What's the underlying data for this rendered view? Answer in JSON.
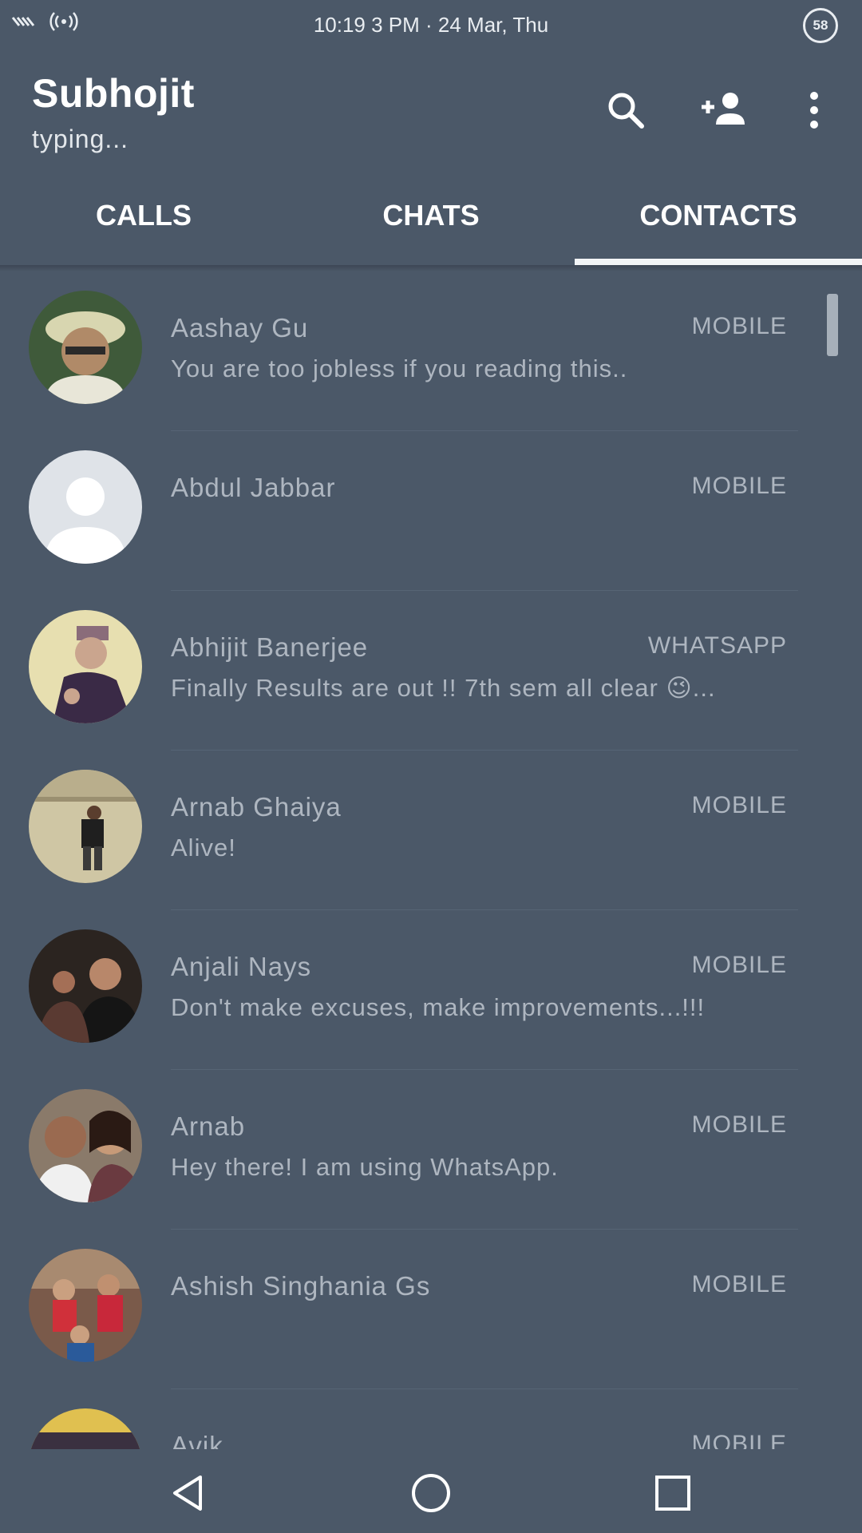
{
  "status_bar": {
    "time": "10:19 3 PM · 24 Mar, Thu",
    "badge": "58",
    "icons": [
      "signal-icon",
      "hotspot-icon"
    ]
  },
  "header": {
    "title": "Subhojit",
    "subtitle": "typing...",
    "actions": [
      "search-icon",
      "add-contact-icon",
      "more-vert-icon"
    ]
  },
  "tabs": [
    {
      "label": "CALLS",
      "selected": false
    },
    {
      "label": "CHATS",
      "selected": false
    },
    {
      "label": "CONTACTS",
      "selected": true
    }
  ],
  "contacts": [
    {
      "name": "Aashay Gu",
      "type": "MOBILE",
      "status": "You are too jobless if you reading this.."
    },
    {
      "name": "Abdul Jabbar",
      "type": "MOBILE",
      "status": ""
    },
    {
      "name": "Abhijit Banerjee",
      "type": "WHATSAPP",
      "status": "Finally Results are out !! 7th sem all clear 😉..."
    },
    {
      "name": "Arnab Ghaiya",
      "type": "MOBILE",
      "status": "Alive!"
    },
    {
      "name": "Anjali Nays",
      "type": "MOBILE",
      "status": "Don't make excuses, make improvements...!!!"
    },
    {
      "name": "Arnab",
      "type": "MOBILE",
      "status": "Hey there! I am using WhatsApp."
    },
    {
      "name": "Ashish Singhania Gs",
      "type": "MOBILE",
      "status": ""
    },
    {
      "name": "Avik",
      "type": "MOBILE",
      "status": ""
    }
  ],
  "colors": {
    "background": "#4b5868",
    "text_primary": "#ffffff",
    "text_secondary": "#aeb6c0"
  },
  "nav": [
    "back-icon",
    "home-icon",
    "recents-icon"
  ]
}
